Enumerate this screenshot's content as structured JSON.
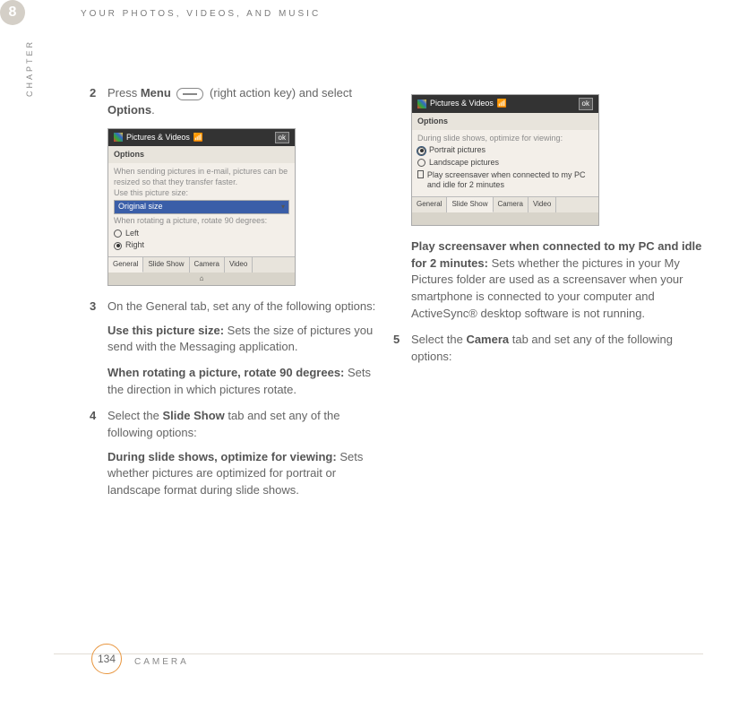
{
  "chapter_num": "8",
  "chapter_side": "CHAPTER",
  "header": "YOUR PHOTOS, VIDEOS, AND MUSIC",
  "page_num": "134",
  "footer": "CAMERA",
  "steps": {
    "s2": {
      "num": "2",
      "a": "Press ",
      "b_bold": "Menu",
      "c": " (right action key) and select ",
      "d_bold": "Options",
      "e": "."
    },
    "s3": {
      "num": "3",
      "text": "On the General tab, set any of the following options:"
    },
    "p1": {
      "lead": "Use this picture size:",
      "body": " Sets the size of pictures you send with the Messaging application."
    },
    "p2": {
      "lead": "When rotating a picture, rotate 90 degrees:",
      "body": " Sets the direction in which pictures rotate."
    },
    "s4": {
      "num": "4",
      "a": "Select the ",
      "b_bold": "Slide Show",
      "c": " tab and set any of the following options:"
    },
    "p3": {
      "lead": "During slide shows, optimize for viewing:",
      "body": " Sets whether pictures are optimized for portrait or landscape format during slide shows."
    },
    "p4": {
      "lead": "Play screensaver when connected to my PC and idle for 2 minutes:",
      "body": " Sets whether the pictures in your My Pictures folder are used as a screensaver when your smartphone is connected to your computer and ActiveSync® desktop software is not running."
    },
    "s5": {
      "num": "5",
      "a": "Select the ",
      "b_bold": "Camera",
      "c": " tab and set any of the following options:"
    }
  },
  "shot1": {
    "title": "Pictures & Videos",
    "ok": "ok",
    "sub": "Options",
    "line1": "When sending pictures in e-mail, pictures can be resized so that they transfer faster.",
    "line2": "Use this picture size:",
    "sel": "Original size",
    "line3": "When rotating a picture, rotate 90 degrees:",
    "r1": "Left",
    "r2": "Right",
    "tabs": [
      "General",
      "Slide Show",
      "Camera",
      "Video"
    ],
    "soft": "⌂"
  },
  "shot2": {
    "title": "Pictures & Videos",
    "ok": "ok",
    "sub": "Options",
    "line1": "During slide shows, optimize for viewing:",
    "r1": "Portrait pictures",
    "r2": "Landscape pictures",
    "chk": "Play screensaver when connected to my PC and idle for 2 minutes",
    "tabs": [
      "General",
      "Slide Show",
      "Camera",
      "Video"
    ]
  }
}
